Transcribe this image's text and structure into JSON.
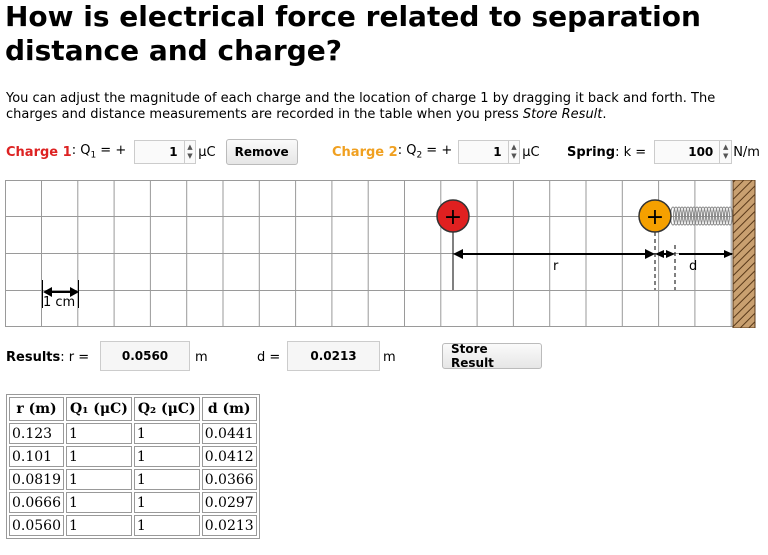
{
  "title": "How is electrical force related to separation distance and charge?",
  "description": {
    "text1": "You can adjust the magnitude of each charge and the location of charge 1 by dragging it back and forth. The charges and distance measurements are recorded in the table when you press ",
    "text_italic": "Store Result",
    "text2": "."
  },
  "controls": {
    "charge1_label": "Charge 1",
    "charge1_expr": ": Q",
    "charge1_sub": "1",
    "charge1_eq": " = +",
    "charge1_value": "1",
    "charge1_unit": "μC",
    "remove_label": "Remove",
    "charge2_label": "Charge 2",
    "charge2_expr": ": Q",
    "charge2_sub": "2",
    "charge2_eq": " = +",
    "charge2_value": "1",
    "charge2_unit": "μC",
    "spring_label": "Spring",
    "spring_expr": ": k =",
    "spring_value": "100",
    "spring_unit": "N/m"
  },
  "sim": {
    "plus": "+",
    "scale_label": "1 cm",
    "r_label": "r",
    "d_label": "d",
    "charge1_color": "#e02020",
    "charge2_color": "#f5a000"
  },
  "results": {
    "label": "Results",
    "r_expr": ": r =",
    "r_value": "0.0560",
    "r_unit": "m",
    "d_expr": "d =",
    "d_value": "0.0213",
    "d_unit": "m",
    "store_label": "Store Result"
  },
  "table": {
    "headers": [
      "r (m)",
      "Q₁ (μC)",
      "Q₂ (μC)",
      "d (m)"
    ],
    "rows": [
      [
        "0.123",
        "1",
        "1",
        "0.0441"
      ],
      [
        "0.101",
        "1",
        "1",
        "0.0412"
      ],
      [
        "0.0819",
        "1",
        "1",
        "0.0366"
      ],
      [
        "0.0666",
        "1",
        "1",
        "0.0297"
      ],
      [
        "0.0560",
        "1",
        "1",
        "0.0213"
      ]
    ]
  }
}
